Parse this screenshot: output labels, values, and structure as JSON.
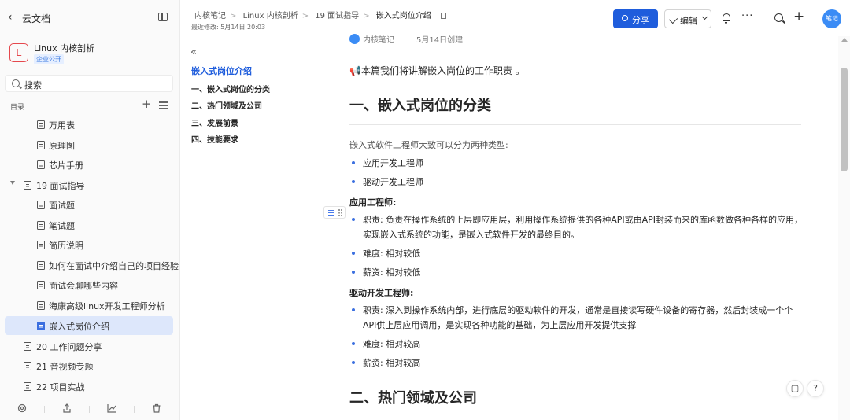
{
  "sidebar": {
    "back_label": "云文档",
    "kb": {
      "logo_letter": "L",
      "name": "Linux 内核剖析",
      "badge": "企业公开"
    },
    "search_placeholder": "搜索",
    "toc_label": "目录",
    "items": [
      {
        "label": "万用表",
        "level": 2
      },
      {
        "label": "原理图",
        "level": 2
      },
      {
        "label": "芯片手册",
        "level": 2
      },
      {
        "label": "19 面试指导",
        "level": 1,
        "expanded": true
      },
      {
        "label": "面试题",
        "level": 2
      },
      {
        "label": "笔试题",
        "level": 2
      },
      {
        "label": "简历说明",
        "level": 2
      },
      {
        "label": "如何在面试中介绍自己的项目经验",
        "level": 2
      },
      {
        "label": "面试会聊哪些内容",
        "level": 2
      },
      {
        "label": "海康高级linux开发工程师分析",
        "level": 2
      },
      {
        "label": "嵌入式岗位介绍",
        "level": 2,
        "active": true
      },
      {
        "label": "20 工作问题分享",
        "level": 1
      },
      {
        "label": "21 音视频专题",
        "level": 1
      },
      {
        "label": "22 项目实战",
        "level": 1
      }
    ],
    "bottom_icons": [
      "settings-icon",
      "share-out-icon",
      "chart-icon",
      "trash-icon"
    ]
  },
  "header": {
    "breadcrumbs": [
      "内核笔记",
      "Linux 内核剖析",
      "19 面试指导",
      "嵌入式岗位介绍"
    ],
    "last_modified": "最近修改: 5月14日 20:03",
    "share_label": "分享",
    "edit_label": "编辑",
    "avatar_text": "笔记"
  },
  "outline": {
    "items": [
      {
        "label": "嵌入式岗位介绍",
        "active": true
      },
      {
        "label": "一、嵌入式岗位的分类"
      },
      {
        "label": "二、热门领域及公司"
      },
      {
        "label": "三、发展前景"
      },
      {
        "label": "四、技能要求"
      }
    ]
  },
  "doc": {
    "author": "内核笔记",
    "created": "5月14日创建",
    "intro_icon": "megaphone-icon",
    "intro": "本篇我们将讲解嵌入岗位的工作职责 。",
    "h1_1": "一、嵌入式岗位的分类",
    "p1": "嵌入式软件工程师大致可以分为两种类型:",
    "types": [
      "应用开发工程师",
      "驱动开发工程师"
    ],
    "app_heading": "应用工程师:",
    "app_items": [
      "职责: 负责在操作系统的上层即应用层，利用操作系统提供的各种API或由API封装而来的库函数做各种各样的应用，实现嵌入式系统的功能，是嵌入式软件开发的最终目的。",
      "难度: 相对较低",
      "薪资: 相对较低"
    ],
    "drv_heading": "驱动开发工程师:",
    "drv_items": [
      "职责: 深入到操作系统内部，进行底层的驱动软件的开发，通常是直接读写硬件设备的寄存器，然后封装成一个个API供上层应用调用，是实现各种功能的基础，为上层应用开发提供支撑",
      "难度: 相对较高",
      "薪资: 相对较高"
    ],
    "h1_2": "二、热门领域及公司"
  },
  "colors": {
    "accent": "#1f5ddc",
    "active_bg": "#dde7fb",
    "kb_logo": "#e5484d",
    "bullet": "#3b6fe0"
  }
}
